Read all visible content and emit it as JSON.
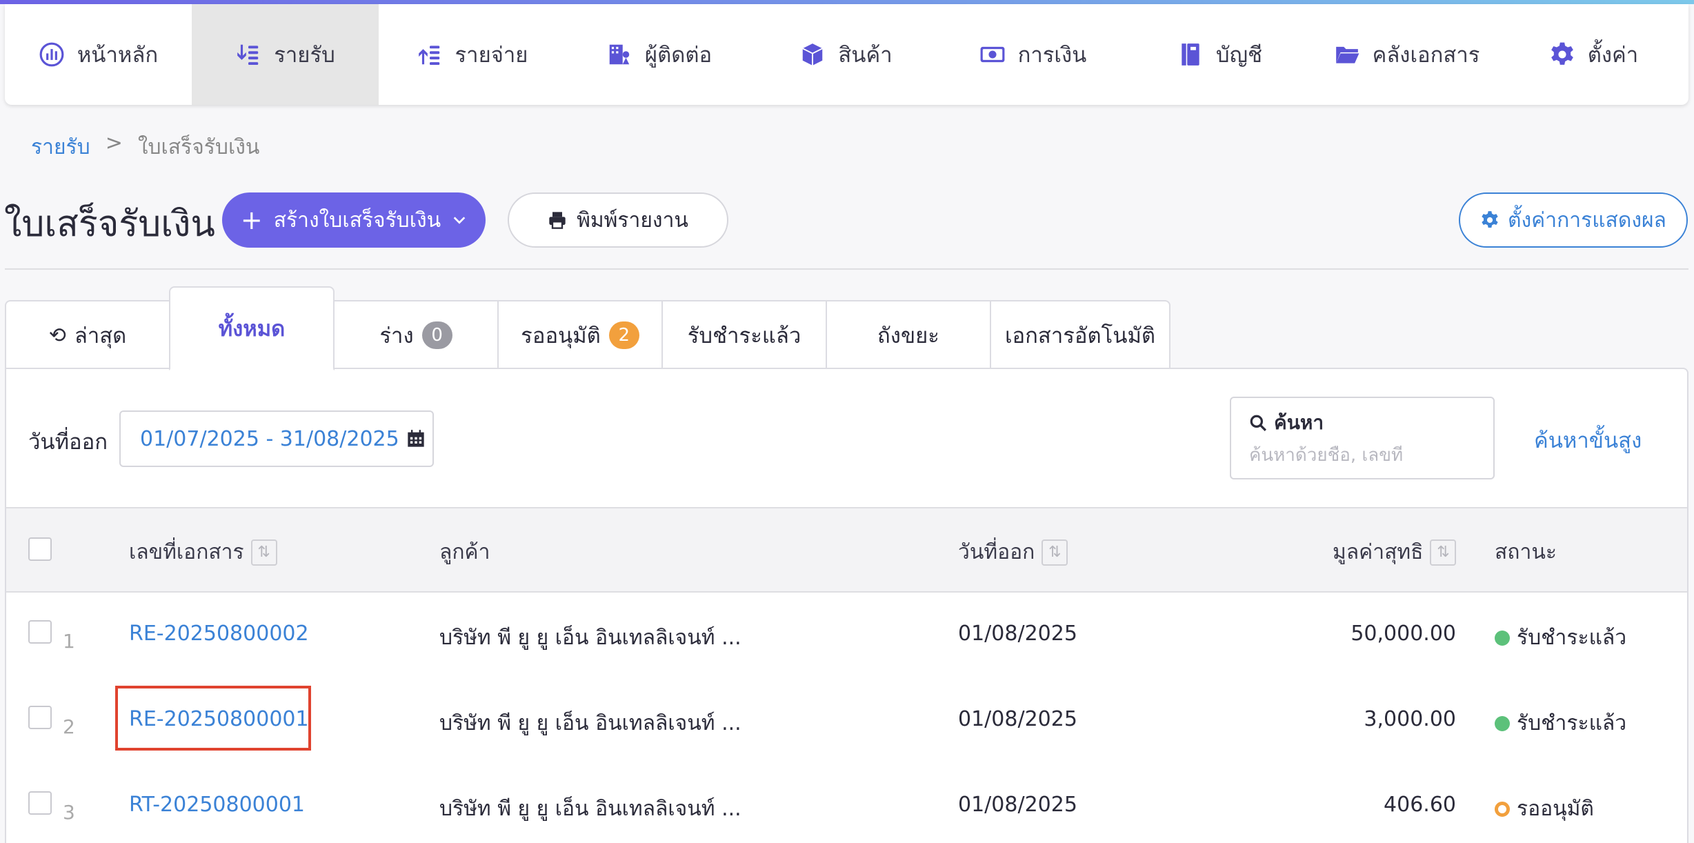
{
  "nav": {
    "items": [
      {
        "label": "หน้าหลัก",
        "icon": "dashboard-icon"
      },
      {
        "label": "รายรับ",
        "icon": "income-icon"
      },
      {
        "label": "รายจ่าย",
        "icon": "expense-icon"
      },
      {
        "label": "ผู้ติดต่อ",
        "icon": "contacts-icon"
      },
      {
        "label": "สินค้า",
        "icon": "box-icon"
      },
      {
        "label": "การเงิน",
        "icon": "money-icon"
      },
      {
        "label": "บัญชี",
        "icon": "ledger-icon"
      },
      {
        "label": "คลังเอกสาร",
        "icon": "folder-icon"
      },
      {
        "label": "ตั้งค่า",
        "icon": "gear-icon"
      }
    ],
    "active_index": 1
  },
  "breadcrumb": {
    "parent": "รายรับ",
    "separator": ">",
    "current": "ใบเสร็จรับเงิน"
  },
  "header": {
    "title": "ใบเสร็จรับเงิน",
    "create_label": "สร้างใบเสร็จรับเงิน",
    "print_label": "พิมพ์รายงาน",
    "display_label": "ตั้งค่าการแสดงผล"
  },
  "tabs": [
    {
      "label": "ล่าสุด"
    },
    {
      "label": "ทั้งหมด"
    },
    {
      "label": "ร่าง",
      "badge": "0"
    },
    {
      "label": "รออนุมัติ",
      "badge": "2"
    },
    {
      "label": "รับชำระแล้ว"
    },
    {
      "label": "ถังขยะ"
    },
    {
      "label": "เอกสารอัตโนมัติ"
    }
  ],
  "filter": {
    "date_label": "วันที่ออก",
    "date_range": "01/07/2025 - 31/08/2025",
    "search_title": "ค้นหา",
    "search_placeholder": "ค้นหาด้วยชื่อ, เลขที่",
    "advanced_label": "ค้นหาขั้นสูง"
  },
  "table": {
    "headers": {
      "doc_no": "เลขที่เอกสาร",
      "customer": "ลูกค้า",
      "date": "วันที่ออก",
      "amount": "มูลค่าสุทธิ",
      "status": "สถานะ"
    },
    "rows": [
      {
        "num": "1",
        "doc_no": "RE-20250800002",
        "customer": "บริษัท พี ยู ยู เอ็น อินเทลลิเจนท์ ...",
        "date": "01/08/2025",
        "amount": "50,000.00",
        "status": "รับชำระแล้ว"
      },
      {
        "num": "2",
        "doc_no": "RE-20250800001",
        "customer": "บริษัท พี ยู ยู เอ็น อินเทลลิเจนท์ ...",
        "date": "01/08/2025",
        "amount": "3,000.00",
        "status": "รับชำระแล้ว"
      },
      {
        "num": "3",
        "doc_no": "RT-20250800001",
        "customer": "บริษัท พี ยู ยู เอ็น อินเทลลิเจนท์ ...",
        "date": "01/08/2025",
        "amount": "406.60",
        "status": "รออนุมัติ"
      }
    ]
  },
  "colors": {
    "accent": "#6c63e6",
    "link": "#3b82d6",
    "paid": "#5cc17a",
    "pending": "#f2a03d",
    "highlight": "#e0432f"
  }
}
